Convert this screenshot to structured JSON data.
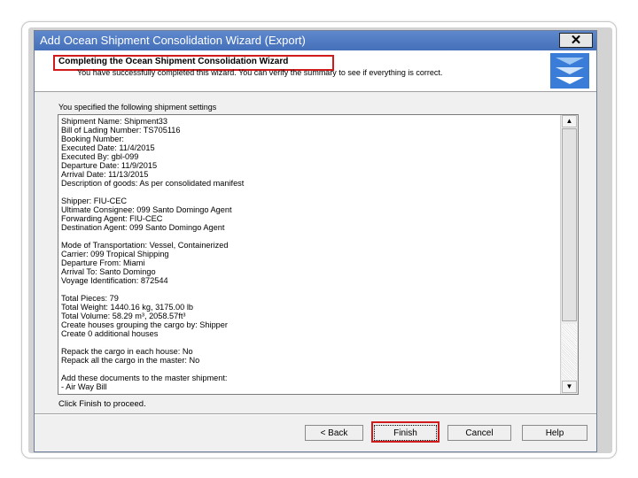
{
  "window": {
    "title": "Add Ocean Shipment Consolidation Wizard (Export)",
    "close_glyph": "✕"
  },
  "header": {
    "title": "Completing the Ocean Shipment Consolidation Wizard",
    "description": "You have successfully completed this wizard.  You can verify the summary to see if everything is correct."
  },
  "summary": {
    "label": "You specified the following shipment settings",
    "lines": [
      "Shipment Name: Shipment33",
      "Bill of Lading Number: TS705116",
      "Booking Number:",
      "Executed Date: 11/4/2015",
      "Executed By: gbl-099",
      "Departure Date: 11/9/2015",
      "Arrival Date: 11/13/2015",
      "Description of goods: As per consolidated manifest",
      "",
      "Shipper: FIU-CEC",
      "Ultimate Consignee: 099 Santo Domingo Agent",
      "Forwarding Agent: FIU-CEC",
      "Destination Agent: 099 Santo Domingo Agent",
      "",
      "Mode of Transportation: Vessel, Containerized",
      "Carrier: 099 Tropical Shipping",
      "Departure From: Miami",
      "Arrival To: Santo Domingo",
      "Voyage Identification: 872544",
      "",
      "Total Pieces: 79",
      "Total Weight: 1440.16 kg, 3175.00 lb",
      "Total Volume: 58.29 m³, 2058.57ft³",
      "Create houses grouping the cargo by: Shipper",
      "Create 0 additional houses",
      "",
      "Repack the cargo in each house: No",
      "Repack all the cargo in the master: No",
      "",
      "Add these documents to the master shipment:",
      "- Air Way Bill"
    ]
  },
  "footer": {
    "note": "Click Finish to proceed."
  },
  "buttons": {
    "back": "< Back",
    "finish": "Finish",
    "cancel": "Cancel",
    "help": "Help"
  },
  "colors": {
    "titlebar": "#4f79c1",
    "highlight": "#d11a1a"
  },
  "icons": {
    "scroll_up": "▲",
    "scroll_down": "▼"
  }
}
